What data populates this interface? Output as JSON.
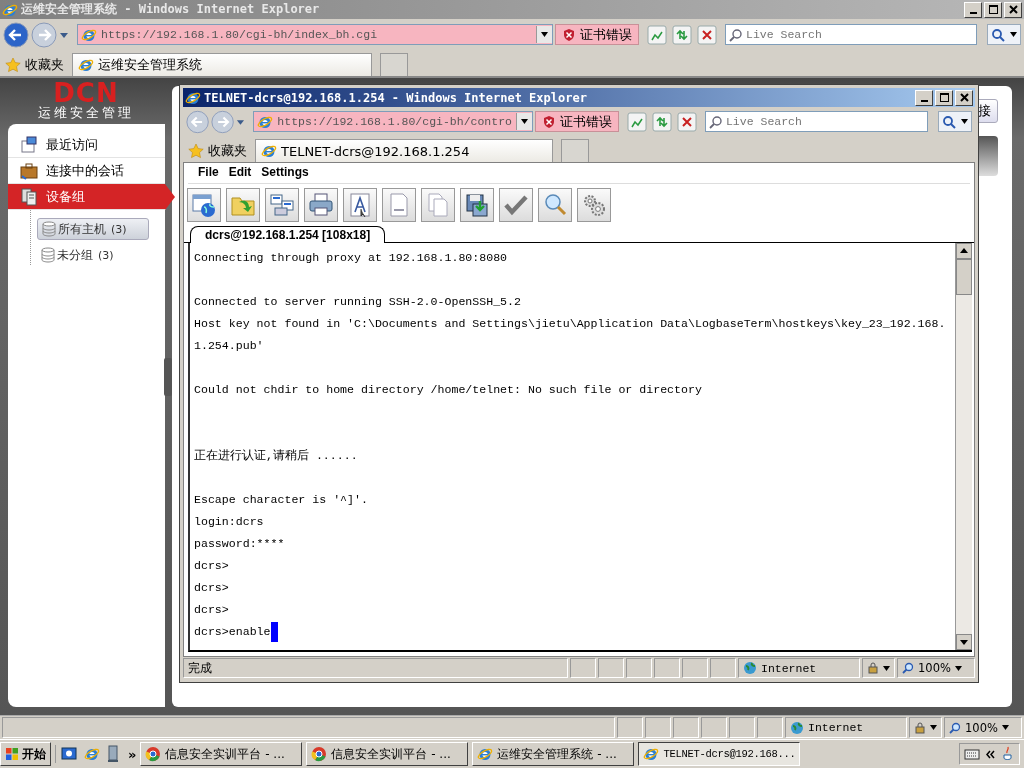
{
  "window": {
    "title": "运维安全管理系统 - Windows Internet Explorer",
    "address": "https://192.168.1.80/cgi-bh/index_bh.cgi",
    "cert_error": "证书错误",
    "search": {
      "placeholder": "Live Search"
    },
    "favorites": "收藏夹",
    "tabs": [
      {
        "label": "运维安全管理系统",
        "selected": true
      }
    ]
  },
  "app": {
    "logo": "DCN",
    "logo_subtitle": "运维安全管理",
    "nav": [
      {
        "label": "最近访问",
        "selected": false,
        "kind": "recent"
      },
      {
        "label": "连接中的会话",
        "selected": false,
        "kind": "sessions"
      },
      {
        "label": "设备组",
        "selected": true,
        "kind": "groups"
      }
    ],
    "tree": [
      {
        "label": "所有主机",
        "count": "(3)",
        "selected": true
      },
      {
        "label": "未分组",
        "count": "(3)",
        "selected": false
      }
    ],
    "connect_button": "接"
  },
  "popup": {
    "title": "TELNET-dcrs@192.168.1.254 - Windows Internet Explorer",
    "address": "https://192.168.1.80/cgi-bh/contro",
    "cert_error": "证书错误",
    "search": {
      "placeholder": "Live Search"
    },
    "favorites": "收藏夹",
    "tabs": [
      {
        "label": "TELNET-dcrs@192.168.1.254",
        "selected": true
      }
    ],
    "menu": [
      "File",
      "Edit",
      "Settings"
    ],
    "session_tab": "dcrs@192.168.1.254 [108x18]",
    "terminal": [
      {
        "kind": "text",
        "text": "Connecting through proxy at 192.168.1.80:8080"
      },
      {
        "kind": "blank"
      },
      {
        "kind": "text",
        "text": "Connected to server running SSH-2.0-OpenSSH_5.2"
      },
      {
        "kind": "text",
        "text": "Host key not found in 'C:\\Documents and Settings\\jietu\\Application Data\\LogbaseTerm\\hostkeys\\key_23_192.168.1.254.pub'"
      },
      {
        "kind": "blank"
      },
      {
        "kind": "text",
        "text": "Could not chdir to home directory /home/telnet: No such file or directory"
      },
      {
        "kind": "blank"
      },
      {
        "kind": "blank"
      },
      {
        "kind": "text",
        "text": "正在进行认证,请稍后 ......"
      },
      {
        "kind": "blank"
      },
      {
        "kind": "text",
        "text": "Escape character is '^]'."
      },
      {
        "kind": "text",
        "text": "login:dcrs"
      },
      {
        "kind": "text",
        "text": "password:****"
      },
      {
        "kind": "text",
        "text": "dcrs>"
      },
      {
        "kind": "text",
        "text": "dcrs>"
      },
      {
        "kind": "text",
        "text": "dcrs>"
      },
      {
        "kind": "input",
        "text": "dcrs>enable"
      }
    ],
    "status": {
      "text": "完成",
      "zone": "Internet",
      "zoom": "100%"
    }
  },
  "status_bar": {
    "zone": "Internet",
    "zoom": "100%"
  },
  "taskbar": {
    "start": "开始",
    "more": "»",
    "tasks": [
      {
        "label": "信息安全实训平台 - ...",
        "selected": false,
        "kind": "chrome"
      },
      {
        "label": "信息安全实训平台 - ...",
        "selected": false,
        "kind": "chrome"
      },
      {
        "label": "运维安全管理系统 - ...",
        "selected": false,
        "kind": "ie"
      },
      {
        "label": "TELNET-dcrs@192.168...",
        "selected": true,
        "kind": "ie"
      }
    ]
  }
}
